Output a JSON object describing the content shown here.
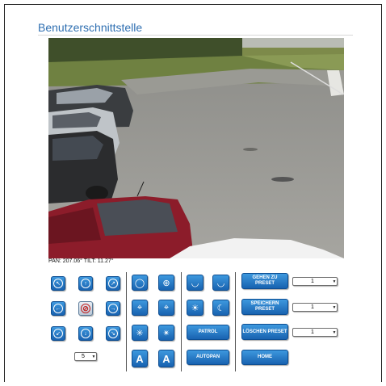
{
  "page": {
    "title": "Benutzerschnittstelle"
  },
  "video": {
    "pan_tilt_readout": "PAN: 207.06° TILT: 11.27°"
  },
  "controls": {
    "step_select": {
      "value": "5"
    },
    "patrol_label": "PATROL",
    "autopan_label": "AUTOPAN",
    "home_label": "HOME",
    "goto_preset_label": "GEHEN ZU PRESET",
    "save_preset_label": "SPEICHERN PRESET",
    "delete_preset_label": "LÖSCHEN PRESET",
    "goto_preset_value": "1",
    "save_preset_value": "1",
    "delete_preset_value": "1"
  },
  "colors": {
    "accent": "#2f6fb1",
    "button": "#1f74c4"
  }
}
